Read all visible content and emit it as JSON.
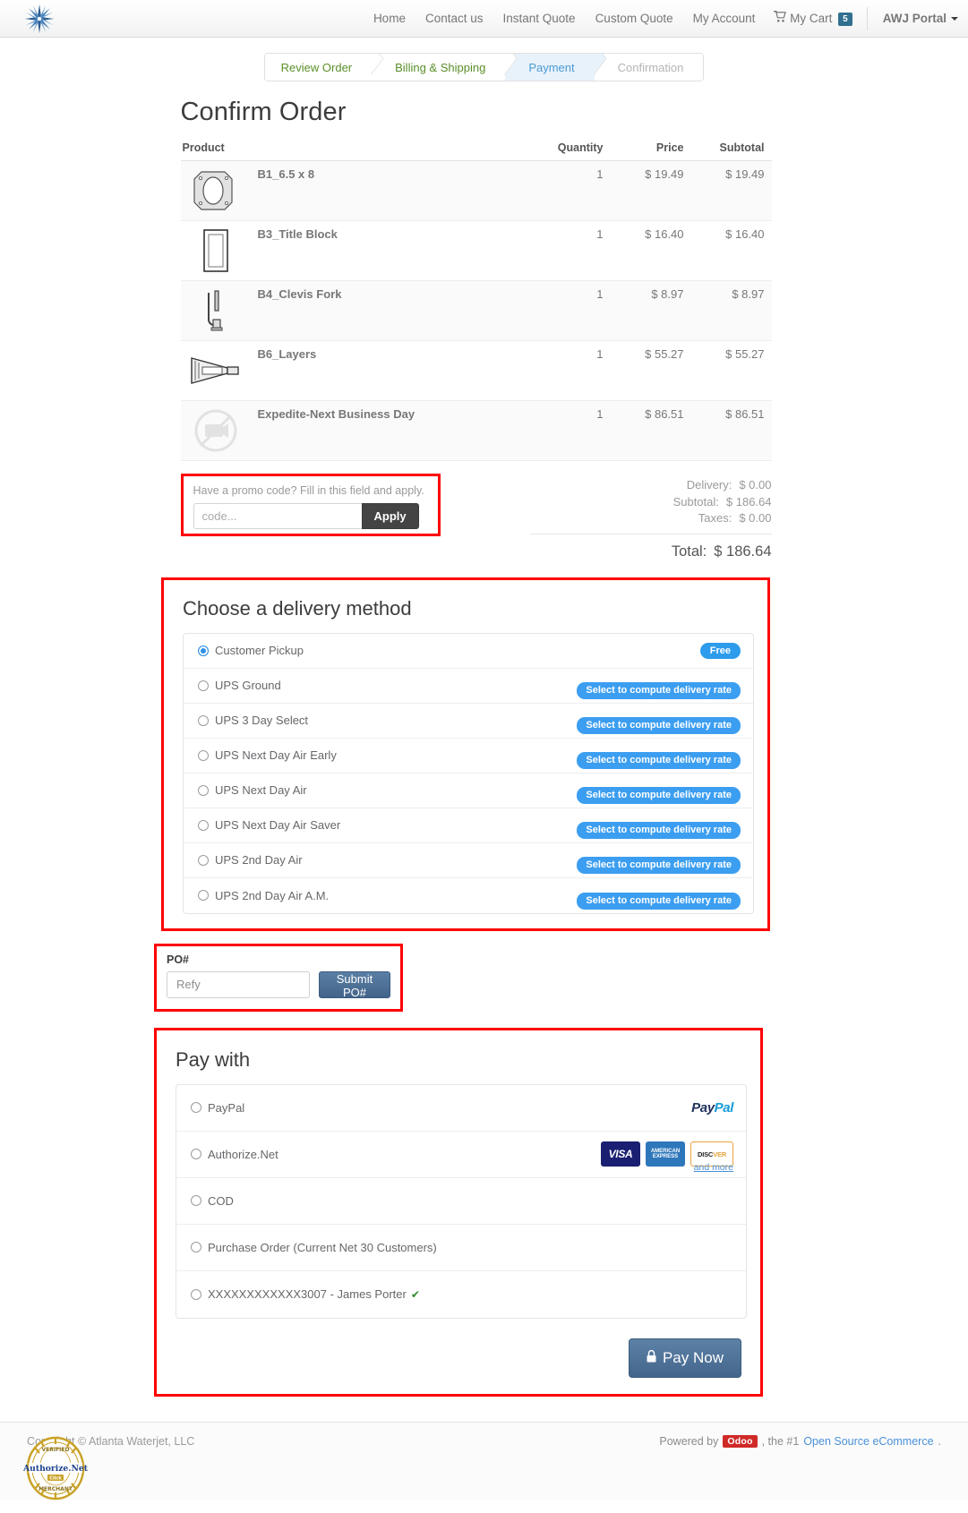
{
  "nav": {
    "logo_name": "atlanta-waterjet-logo",
    "links": [
      "Home",
      "Contact us",
      "Instant Quote",
      "Custom Quote",
      "My Account"
    ],
    "cart_label": "My Cart",
    "cart_count": "5",
    "portal_label": "AWJ Portal"
  },
  "wizard": {
    "steps": [
      {
        "label": "Review Order",
        "state": "done"
      },
      {
        "label": "Billing & Shipping",
        "state": "done"
      },
      {
        "label": "Payment",
        "state": "current"
      },
      {
        "label": "Confirmation",
        "state": "future"
      }
    ]
  },
  "order": {
    "title": "Confirm Order",
    "headers": [
      "Product",
      "Quantity",
      "Price",
      "Subtotal"
    ],
    "rows": [
      {
        "thumb": "octagon-plate-icon",
        "name": "B1_6.5 x 8",
        "qty": "1",
        "price": "$ 19.49",
        "subtotal": "$ 19.49"
      },
      {
        "thumb": "title-block-icon",
        "name": "B3_Title Block",
        "qty": "1",
        "price": "$ 16.40",
        "subtotal": "$ 16.40"
      },
      {
        "thumb": "clevis-fork-icon",
        "name": "B4_Clevis Fork",
        "qty": "1",
        "price": "$ 8.97",
        "subtotal": "$ 8.97"
      },
      {
        "thumb": "layers-wedge-icon",
        "name": "B6_Layers",
        "qty": "1",
        "price": "$ 55.27",
        "subtotal": "$ 55.27"
      },
      {
        "thumb": "no-image-icon",
        "name": "Expedite-Next Business Day",
        "qty": "1",
        "price": "$ 86.51",
        "subtotal": "$ 86.51"
      }
    ]
  },
  "promo": {
    "label": "Have a promo code? Fill in this field and apply.",
    "placeholder": "code...",
    "value": "",
    "apply_label": "Apply"
  },
  "totals": {
    "delivery_label": "Delivery:",
    "delivery_value": "$ 0.00",
    "subtotal_label": "Subtotal:",
    "subtotal_value": "$ 186.64",
    "taxes_label": "Taxes:",
    "taxes_value": "$ 0.00",
    "total_label": "Total:",
    "total_value": "$ 186.64"
  },
  "delivery": {
    "title": "Choose a delivery method",
    "compute_badge": "Select to compute delivery rate",
    "free_badge": "Free",
    "methods": [
      {
        "label": "Customer Pickup",
        "selected": true,
        "badge": "free"
      },
      {
        "label": "UPS Ground",
        "selected": false,
        "badge": "compute"
      },
      {
        "label": "UPS 3 Day Select",
        "selected": false,
        "badge": "compute"
      },
      {
        "label": "UPS Next Day Air Early",
        "selected": false,
        "badge": "compute"
      },
      {
        "label": "UPS Next Day Air",
        "selected": false,
        "badge": "compute"
      },
      {
        "label": "UPS Next Day Air Saver",
        "selected": false,
        "badge": "compute"
      },
      {
        "label": "UPS 2nd Day Air",
        "selected": false,
        "badge": "compute"
      },
      {
        "label": "UPS 2nd Day Air A.M.",
        "selected": false,
        "badge": "compute"
      }
    ]
  },
  "po": {
    "label": "PO#",
    "placeholder": "Refy",
    "value": "",
    "submit_label": "Submit PO#"
  },
  "payment": {
    "title": "Pay with",
    "and_more": "and more",
    "methods": [
      {
        "label": "PayPal",
        "selected": false,
        "logos": [
          "paypal"
        ]
      },
      {
        "label": "Authorize.Net",
        "selected": false,
        "logos": [
          "visa",
          "amex",
          "discover"
        ]
      },
      {
        "label": "COD",
        "selected": false,
        "logos": []
      },
      {
        "label": "Purchase Order (Current Net 30 Customers)",
        "selected": false,
        "logos": []
      },
      {
        "label": "XXXXXXXXXXXX3007 - James Porter",
        "selected": false,
        "logos": [],
        "verified": true
      }
    ],
    "pay_now_label": "Pay Now"
  },
  "footer": {
    "copyright": "Copyright © Atlanta Waterjet, LLC",
    "powered_prefix": "Powered by",
    "odoo": "Odoo",
    "powered_mid": ", the #1",
    "powered_link": "Open Source eCommerce",
    "powered_suffix": ".",
    "seal_top": "VERIFIED",
    "seal_name": "Authorize.Net",
    "seal_sub": "Click",
    "seal_bottom": "MERCHANT"
  },
  "colors": {
    "accent_blue": "#3c9ef0",
    "highlight_red": "#ff0000",
    "wizard_green": "#5a8f29",
    "wizard_blue": "#4b9ad4",
    "button_dark": "#444444",
    "button_steel": "#44658b"
  }
}
